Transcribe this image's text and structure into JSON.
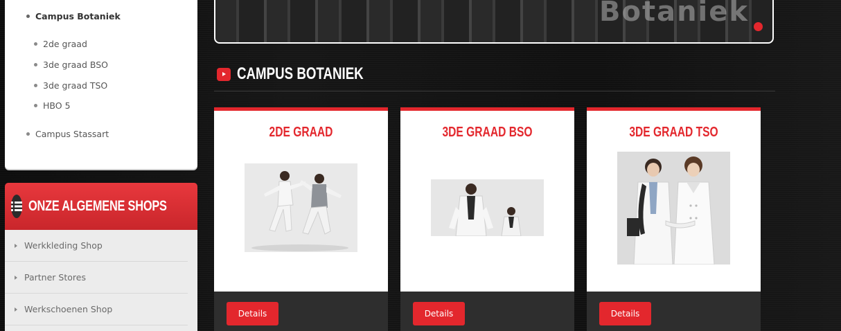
{
  "sidebar": {
    "campus_botaniek": "Campus Botaniek",
    "sub_items": [
      "2de graad",
      "3de graad BSO",
      "3de graad TSO",
      "HBO 5"
    ],
    "campus_stassart": "Campus Stassart"
  },
  "shops": {
    "title": "ONZE ALGEMENE SHOPS",
    "links": [
      "Werkkleding Shop",
      "Partner Stores",
      "Werkschoenen Shop"
    ]
  },
  "banner": {
    "text": "Botaniek"
  },
  "section": {
    "title": "CAMPUS BOTANIEK"
  },
  "cards": [
    {
      "title": "2DE GRAAD",
      "button": "Details"
    },
    {
      "title": "3DE GRAAD BSO",
      "button": "Details"
    },
    {
      "title": "3DE GRAAD TSO",
      "button": "Details"
    }
  ],
  "colors": {
    "accent": "#e3272d",
    "dark": "#2e2e2e"
  }
}
